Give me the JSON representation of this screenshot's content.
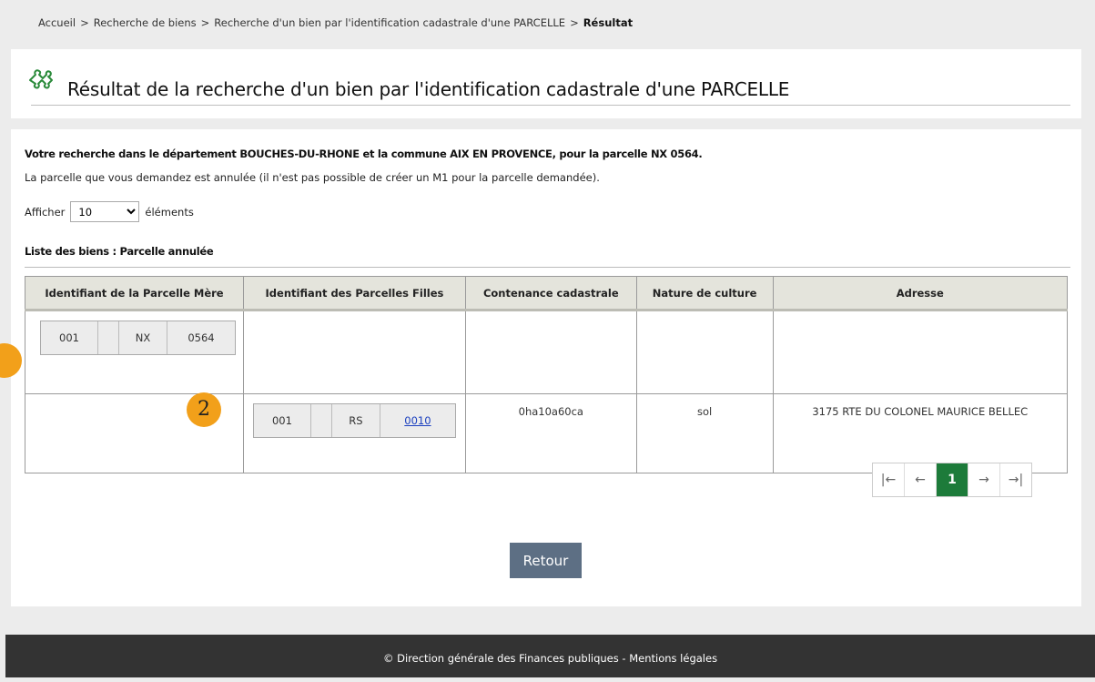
{
  "breadcrumb": {
    "items": [
      "Accueil",
      "Recherche de biens",
      "Recherche d'un bien par l'identification cadastrale d'une PARCELLE"
    ],
    "current": "Résultat",
    "separator": ">"
  },
  "page_title": "Résultat de la recherche d'un bien par l'identification cadastrale d'une PARCELLE",
  "summary": "Votre recherche dans le département BOUCHES-DU-RHONE et la commune AIX EN PROVENCE, pour la parcelle NX 0564.",
  "notice": "La parcelle que vous demandez est annulée (il n'est pas possible de créer un M1 pour la parcelle demandée).",
  "page_size": {
    "prefix": "Afficher",
    "value": "10",
    "suffix": "éléments"
  },
  "list_title": "Liste des biens : Parcelle annulée",
  "table": {
    "headers": [
      "Identifiant de la Parcelle Mère",
      "Identifiant des Parcelles Filles",
      "Contenance cadastrale",
      "Nature de culture",
      "Adresse"
    ],
    "rows": [
      {
        "mother": [
          "001",
          "",
          "NX",
          "0564"
        ],
        "daughter": null,
        "contenance": "",
        "culture": "",
        "adresse": ""
      },
      {
        "mother": null,
        "daughter": [
          "001",
          "",
          "RS",
          "0010"
        ],
        "contenance": "0ha10a60ca",
        "culture": "sol",
        "adresse": "3175 RTE DU COLONEL MAURICE BELLEC"
      }
    ]
  },
  "badges": [
    "2"
  ],
  "pager": {
    "first": "|←",
    "prev": "←",
    "current": "1",
    "next": "→",
    "last": "→|"
  },
  "retour_label": "Retour",
  "footer": {
    "copyright": "© Direction générale des Finances publiques",
    "separator": " - ",
    "legal": "Mentions légales"
  },
  "colors": {
    "active_page": "#1d7b3a",
    "retour_button": "#5d6f84",
    "badge": "#f2a01a",
    "header_bg": "#e4e4dc",
    "footer_bg": "#333333"
  }
}
